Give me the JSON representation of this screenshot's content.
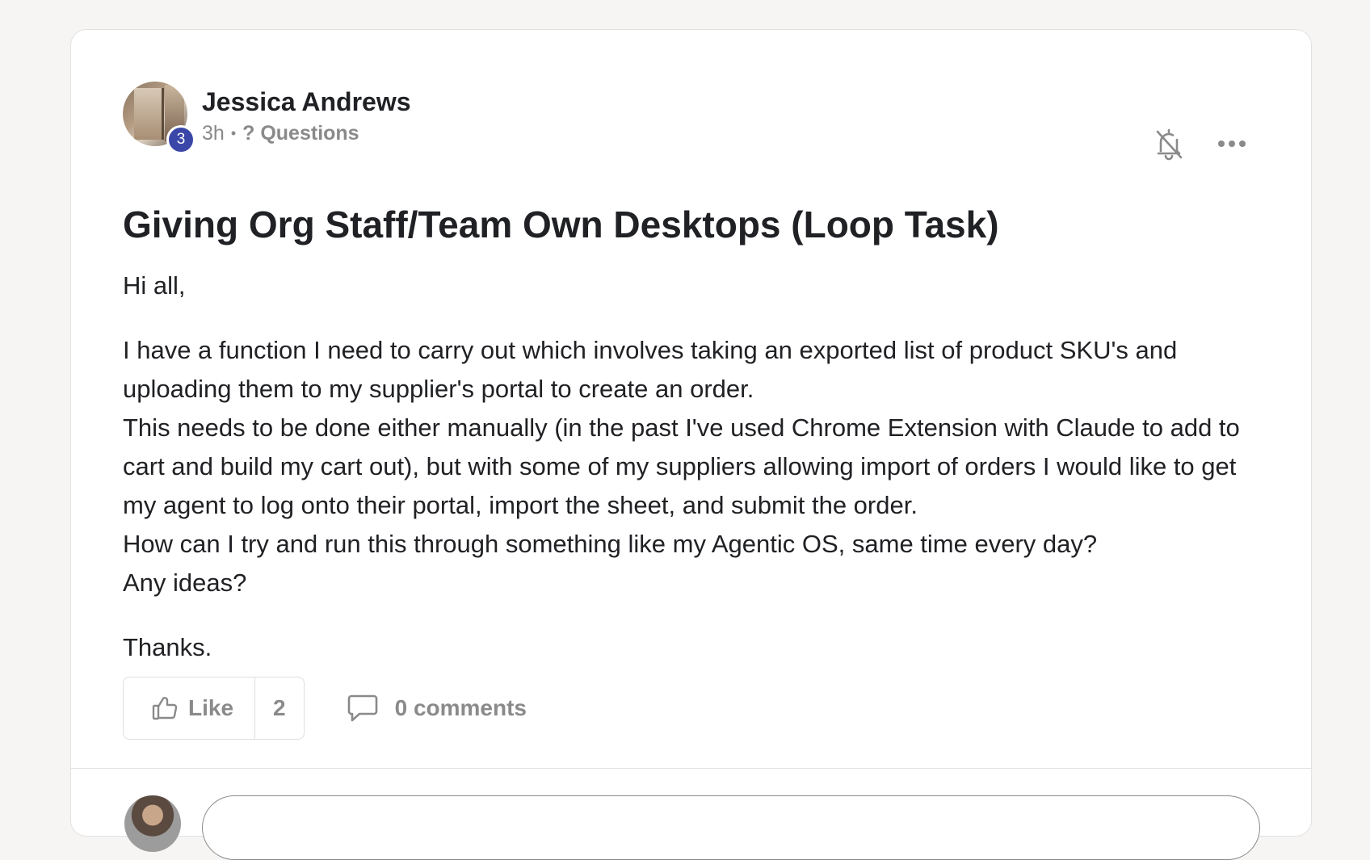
{
  "post": {
    "author": {
      "name": "Jessica Andrews",
      "level": "3"
    },
    "meta": {
      "time": "3h",
      "separator": "•",
      "category": "? Questions"
    },
    "title": "Giving Org Staff/Team Own Desktops (Loop Task)",
    "body": {
      "greeting": "Hi all,",
      "lines": [
        "I have a function I need to carry out which involves taking an exported list of product SKU's and uploading them to my supplier's portal to create an order.",
        "This needs to be done either manually (in the past I've used Chrome Extension with Claude to add to cart and build my cart out), but with some of my suppliers allowing import of orders I would like to get my agent to log onto their portal, import the sheet, and submit the order.",
        "How can I try and run this through something like my Agentic OS, same time every day?",
        "Any ideas?"
      ],
      "signoff": "Thanks."
    },
    "actions": {
      "like_label": "Like",
      "like_count": "2",
      "comments_label": "0 comments"
    }
  },
  "icons": {
    "notifications": "bell-off-icon",
    "more": "more-horizontal-icon",
    "like": "thumbs-up-icon",
    "comment": "comment-bubble-icon"
  },
  "colors": {
    "level_badge": "#3a47a8",
    "muted_text": "#8a8a8a",
    "primary_text": "#202124",
    "page_background": "#f6f5f4"
  }
}
